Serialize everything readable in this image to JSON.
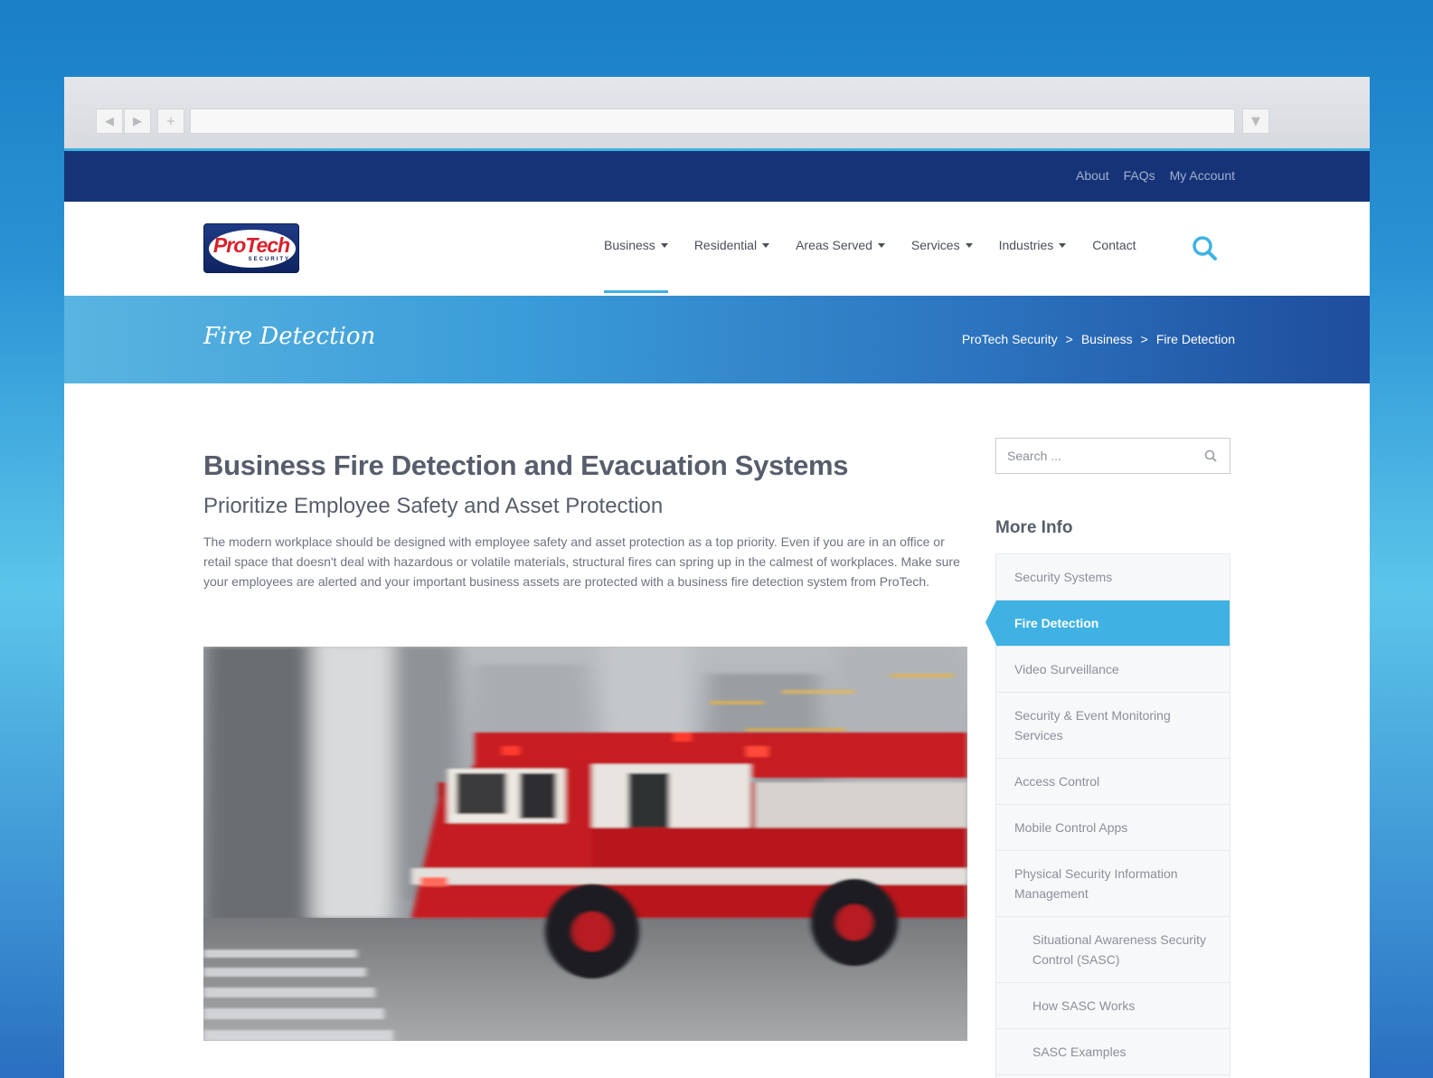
{
  "top_links": [
    "About",
    "FAQs",
    "My Account"
  ],
  "logo": {
    "word": "ProTech",
    "sub": "SECURITY"
  },
  "nav": [
    {
      "label": "Business",
      "caret": true
    },
    {
      "label": "Residential",
      "caret": true
    },
    {
      "label": "Areas Served",
      "caret": true
    },
    {
      "label": "Services",
      "caret": true
    },
    {
      "label": "Industries",
      "caret": true
    },
    {
      "label": "Contact",
      "caret": false
    }
  ],
  "banner": {
    "title": "Fire Detection",
    "breadcrumb": [
      "ProTech Security",
      "Business",
      "Fire Detection"
    ],
    "separator": ">"
  },
  "content": {
    "heading": "Business Fire Detection and Evacuation Systems",
    "subheading": "Prioritize Employee Safety and Asset Protection",
    "paragraph": "The modern workplace should be designed with employee safety and asset protection as a top priority. Even if you are in an office or retail space that doesn't deal with hazardous or volatile materials, structural fires can spring up in the calmest of workplaces. Make sure your employees are alerted and your important business assets are protected with a business fire detection system from ProTech."
  },
  "sidebar": {
    "search_placeholder": "Search ...",
    "more_info_title": "More Info",
    "items": [
      {
        "label": "Security Systems",
        "sub": false
      },
      {
        "label": "Fire Detection",
        "sub": false,
        "active": true
      },
      {
        "label": "Video Surveillance",
        "sub": false
      },
      {
        "label": "Security & Event Monitoring Services",
        "sub": false
      },
      {
        "label": "Access Control",
        "sub": false
      },
      {
        "label": "Mobile Control Apps",
        "sub": false
      },
      {
        "label": "Physical Security Information Management",
        "sub": false
      },
      {
        "label": "Situational Awareness Security Control (SASC)",
        "sub": true
      },
      {
        "label": "How SASC Works",
        "sub": true
      },
      {
        "label": "SASC Examples",
        "sub": true
      }
    ]
  },
  "colors": {
    "accent": "#3fb2e3",
    "topbar": "#163378"
  }
}
